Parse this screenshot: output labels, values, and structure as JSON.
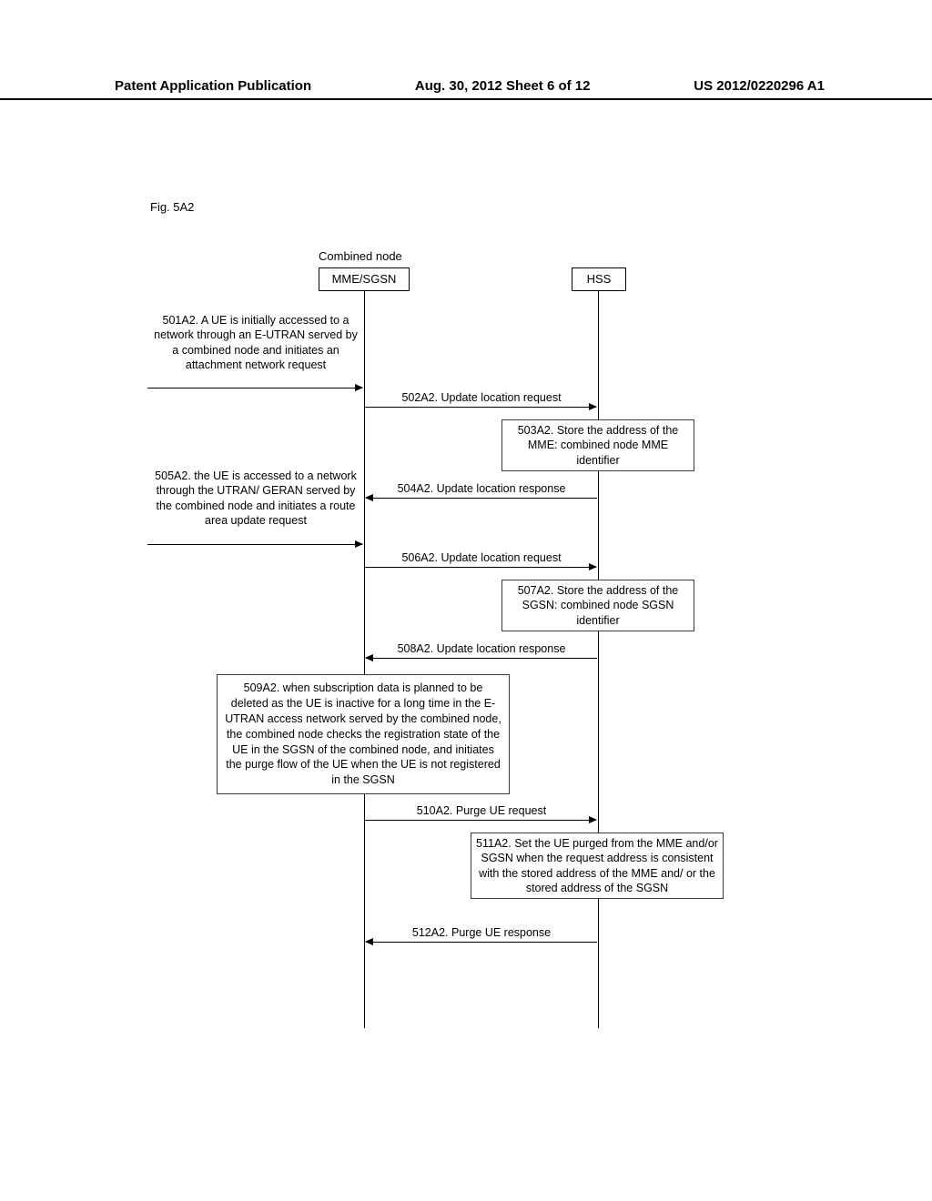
{
  "header": {
    "left": "Patent Application Publication",
    "center": "Aug. 30, 2012  Sheet 6 of 12",
    "right": "US 2012/0220296 A1"
  },
  "fig_label": "Fig. 5A2",
  "combined_label": "Combined node",
  "actors": {
    "mme": "MME/SGSN",
    "hss": "HSS"
  },
  "steps": {
    "s501": "501A2. A UE is initially accessed to a network through an E-UTRAN served by a combined node and initiates an attachment network request",
    "s502": "502A2. Update location request",
    "s503": "503A2. Store the address of the MME:  combined node MME identifier",
    "s504": "504A2. Update location response",
    "s505": "505A2. the UE is accessed to a network through the UTRAN/ GERAN served by the combined node and initiates a route area update request",
    "s506": "506A2. Update location request",
    "s507": "507A2. Store the address of the SGSN:  combined node SGSN identifier",
    "s508": "508A2. Update location response",
    "s509": "509A2. when subscription data is planned to be deleted as the UE is inactive for a long time in the E-UTRAN access network served by the combined node, the combined node checks the registration state of the UE in the SGSN of the combined node, and initiates the purge flow of the UE when the UE is not registered in the SGSN",
    "s510": "510A2. Purge UE request",
    "s511": "511A2. Set the UE purged from the MME and/or SGSN when the request address is consistent with the stored address of the MME and/ or the stored address of the SGSN",
    "s512": "512A2. Purge UE response"
  }
}
